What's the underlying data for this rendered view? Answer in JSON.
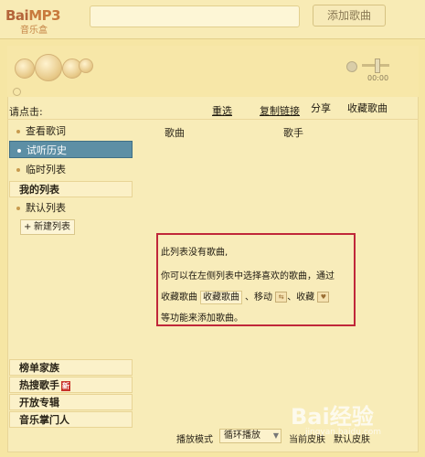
{
  "app": {
    "logo": "Bai",
    "logo_mp3": "MP3",
    "logo_sub": "音乐盒"
  },
  "header": {
    "add_song": "添加歌曲"
  },
  "player": {
    "time": "00:00"
  },
  "toolbar": {
    "prompt": "请点击:",
    "reselect": "重选",
    "copy_link": "复制链接",
    "share": "分享",
    "favorite": "收藏歌曲"
  },
  "sidebar": {
    "items": [
      {
        "label": "查看歌词"
      },
      {
        "label": "试听历史",
        "active": true
      },
      {
        "label": "临时列表"
      }
    ],
    "my_lists_title": "我的列表",
    "default_list": "默认列表",
    "new_list": "新建列表",
    "bottom_nav": [
      "榜单家族",
      "热搜歌手",
      "开放专辑",
      "音乐掌门人"
    ],
    "new_badge": "新"
  },
  "list": {
    "columns": [
      "歌曲",
      "歌手"
    ],
    "empty": {
      "line1": "此列表没有歌曲,",
      "line2": "你可以在左侧列表中选择喜欢的歌曲，通过",
      "line3_a": "收藏歌曲",
      "line3_chip": "收藏歌曲",
      "line3_b": "、移动",
      "line3_c": "、收藏",
      "line4": "等功能来添加歌曲。"
    }
  },
  "footer": {
    "play_mode_label": "播放模式",
    "play_mode_value": "循环播放",
    "skin_label": "当前皮肤",
    "skin_value": "默认皮肤"
  },
  "watermark": {
    "brand": "Bai经验",
    "url": "jingyan.baidu.com"
  },
  "colors": {
    "background": "#f6e6a4",
    "active_item": "#5d8fa5",
    "highlight_border": "#c0273a",
    "badge": "#c8322a"
  }
}
